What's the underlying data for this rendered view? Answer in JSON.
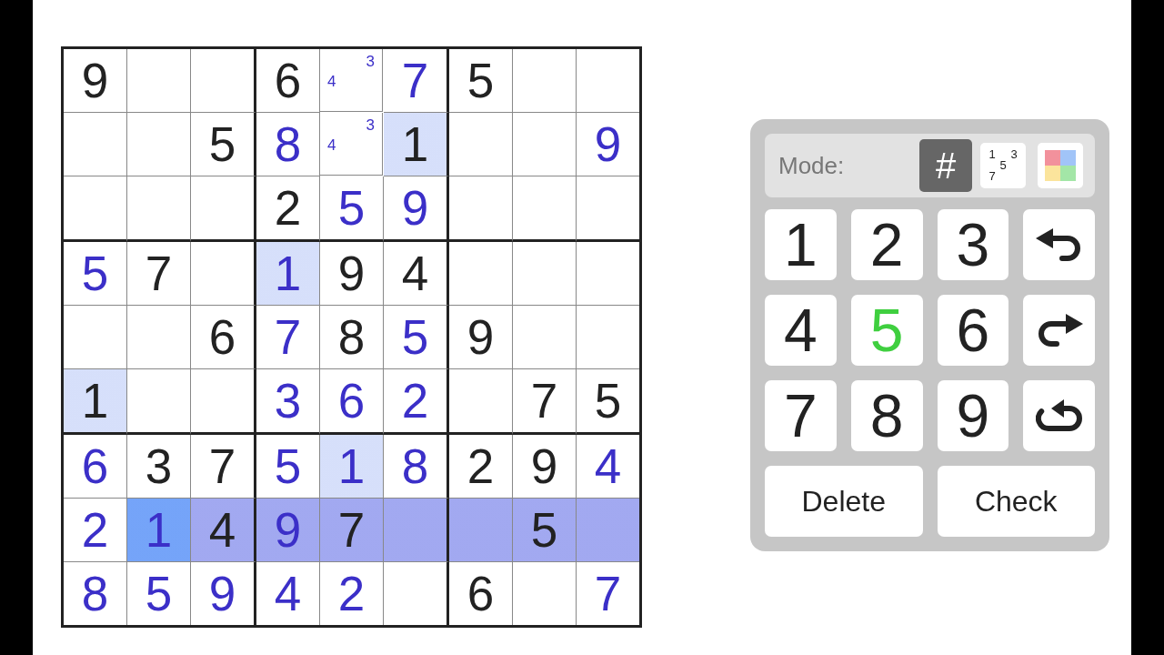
{
  "board": {
    "rows": [
      [
        {
          "kind": "given",
          "value": "9",
          "same_digit": false,
          "in_row": false,
          "selected": false
        },
        {
          "kind": "empty",
          "same_digit": false,
          "in_row": false,
          "selected": false
        },
        {
          "kind": "empty",
          "same_digit": false,
          "in_row": false,
          "selected": false
        },
        {
          "kind": "given",
          "value": "6",
          "same_digit": false,
          "in_row": false,
          "selected": false
        },
        {
          "kind": "notes",
          "notes": [
            {
              "text": "3",
              "kind": "top-right"
            },
            {
              "text": "4",
              "kind": "middle-left"
            }
          ],
          "same_digit": false,
          "in_row": false,
          "selected": false
        },
        {
          "kind": "entry",
          "value": "7",
          "same_digit": false,
          "in_row": false,
          "selected": false
        },
        {
          "kind": "given",
          "value": "5",
          "same_digit": false,
          "in_row": false,
          "selected": false
        },
        {
          "kind": "empty",
          "same_digit": false,
          "in_row": false,
          "selected": false
        },
        {
          "kind": "empty",
          "same_digit": false,
          "in_row": false,
          "selected": false
        }
      ],
      [
        {
          "kind": "empty",
          "same_digit": false,
          "in_row": false,
          "selected": false
        },
        {
          "kind": "empty",
          "same_digit": false,
          "in_row": false,
          "selected": false
        },
        {
          "kind": "given",
          "value": "5",
          "same_digit": false,
          "in_row": false,
          "selected": false
        },
        {
          "kind": "entry",
          "value": "8",
          "same_digit": false,
          "in_row": false,
          "selected": false
        },
        {
          "kind": "notes",
          "notes": [
            {
              "text": "3",
              "kind": "top-right"
            },
            {
              "text": "4",
              "kind": "middle-left"
            }
          ],
          "same_digit": false,
          "in_row": false,
          "selected": false
        },
        {
          "kind": "given",
          "value": "1",
          "same_digit": true,
          "in_row": false,
          "selected": false
        },
        {
          "kind": "empty",
          "same_digit": false,
          "in_row": false,
          "selected": false
        },
        {
          "kind": "empty",
          "same_digit": false,
          "in_row": false,
          "selected": false
        },
        {
          "kind": "entry",
          "value": "9",
          "same_digit": false,
          "in_row": false,
          "selected": false
        }
      ],
      [
        {
          "kind": "empty",
          "same_digit": false,
          "in_row": false,
          "selected": false
        },
        {
          "kind": "empty",
          "same_digit": false,
          "in_row": false,
          "selected": false
        },
        {
          "kind": "empty",
          "same_digit": false,
          "in_row": false,
          "selected": false
        },
        {
          "kind": "given",
          "value": "2",
          "same_digit": false,
          "in_row": false,
          "selected": false
        },
        {
          "kind": "entry",
          "value": "5",
          "same_digit": false,
          "in_row": false,
          "selected": false
        },
        {
          "kind": "entry",
          "value": "9",
          "same_digit": false,
          "in_row": false,
          "selected": false
        },
        {
          "kind": "empty",
          "same_digit": false,
          "in_row": false,
          "selected": false
        },
        {
          "kind": "empty",
          "same_digit": false,
          "in_row": false,
          "selected": false
        },
        {
          "kind": "empty",
          "same_digit": false,
          "in_row": false,
          "selected": false
        }
      ],
      [
        {
          "kind": "entry",
          "value": "5",
          "same_digit": false,
          "in_row": false,
          "selected": false
        },
        {
          "kind": "given",
          "value": "7",
          "same_digit": false,
          "in_row": false,
          "selected": false
        },
        {
          "kind": "empty",
          "same_digit": false,
          "in_row": false,
          "selected": false
        },
        {
          "kind": "entry",
          "value": "1",
          "same_digit": true,
          "in_row": false,
          "selected": false
        },
        {
          "kind": "given",
          "value": "9",
          "same_digit": false,
          "in_row": false,
          "selected": false
        },
        {
          "kind": "given",
          "value": "4",
          "same_digit": false,
          "in_row": false,
          "selected": false
        },
        {
          "kind": "empty",
          "same_digit": false,
          "in_row": false,
          "selected": false
        },
        {
          "kind": "empty",
          "same_digit": false,
          "in_row": false,
          "selected": false
        },
        {
          "kind": "empty",
          "same_digit": false,
          "in_row": false,
          "selected": false
        }
      ],
      [
        {
          "kind": "empty",
          "same_digit": false,
          "in_row": false,
          "selected": false
        },
        {
          "kind": "empty",
          "same_digit": false,
          "in_row": false,
          "selected": false
        },
        {
          "kind": "given",
          "value": "6",
          "same_digit": false,
          "in_row": false,
          "selected": false
        },
        {
          "kind": "entry",
          "value": "7",
          "same_digit": false,
          "in_row": false,
          "selected": false
        },
        {
          "kind": "given",
          "value": "8",
          "same_digit": false,
          "in_row": false,
          "selected": false
        },
        {
          "kind": "entry",
          "value": "5",
          "same_digit": false,
          "in_row": false,
          "selected": false
        },
        {
          "kind": "given",
          "value": "9",
          "same_digit": false,
          "in_row": false,
          "selected": false
        },
        {
          "kind": "empty",
          "same_digit": false,
          "in_row": false,
          "selected": false
        },
        {
          "kind": "empty",
          "same_digit": false,
          "in_row": false,
          "selected": false
        }
      ],
      [
        {
          "kind": "given",
          "value": "1",
          "same_digit": true,
          "in_row": false,
          "selected": false
        },
        {
          "kind": "empty",
          "same_digit": false,
          "in_row": false,
          "selected": false
        },
        {
          "kind": "empty",
          "same_digit": false,
          "in_row": false,
          "selected": false
        },
        {
          "kind": "entry",
          "value": "3",
          "same_digit": false,
          "in_row": false,
          "selected": false
        },
        {
          "kind": "entry",
          "value": "6",
          "same_digit": false,
          "in_row": false,
          "selected": false
        },
        {
          "kind": "entry",
          "value": "2",
          "same_digit": false,
          "in_row": false,
          "selected": false
        },
        {
          "kind": "empty",
          "same_digit": false,
          "in_row": false,
          "selected": false
        },
        {
          "kind": "given",
          "value": "7",
          "same_digit": false,
          "in_row": false,
          "selected": false
        },
        {
          "kind": "given",
          "value": "5",
          "same_digit": false,
          "in_row": false,
          "selected": false
        }
      ],
      [
        {
          "kind": "entry",
          "value": "6",
          "same_digit": false,
          "in_row": false,
          "selected": false
        },
        {
          "kind": "given",
          "value": "3",
          "same_digit": false,
          "in_row": false,
          "selected": false
        },
        {
          "kind": "given",
          "value": "7",
          "same_digit": false,
          "in_row": false,
          "selected": false
        },
        {
          "kind": "entry",
          "value": "5",
          "same_digit": false,
          "in_row": false,
          "selected": false
        },
        {
          "kind": "entry",
          "value": "1",
          "same_digit": true,
          "in_row": false,
          "selected": false
        },
        {
          "kind": "entry",
          "value": "8",
          "same_digit": false,
          "in_row": false,
          "selected": false
        },
        {
          "kind": "given",
          "value": "2",
          "same_digit": false,
          "in_row": false,
          "selected": false
        },
        {
          "kind": "given",
          "value": "9",
          "same_digit": false,
          "in_row": false,
          "selected": false
        },
        {
          "kind": "entry",
          "value": "4",
          "same_digit": false,
          "in_row": false,
          "selected": false
        }
      ],
      [
        {
          "kind": "entry",
          "value": "2",
          "same_digit": false,
          "in_row": false,
          "selected": false
        },
        {
          "kind": "entry",
          "value": "1",
          "same_digit": false,
          "in_row": true,
          "selected": true
        },
        {
          "kind": "given",
          "value": "4",
          "same_digit": false,
          "in_row": true,
          "selected": false
        },
        {
          "kind": "entry",
          "value": "9",
          "same_digit": false,
          "in_row": true,
          "selected": false
        },
        {
          "kind": "given",
          "value": "7",
          "same_digit": false,
          "in_row": true,
          "selected": false
        },
        {
          "kind": "empty",
          "same_digit": false,
          "in_row": true,
          "selected": false
        },
        {
          "kind": "empty",
          "same_digit": false,
          "in_row": true,
          "selected": false
        },
        {
          "kind": "given",
          "value": "5",
          "same_digit": false,
          "in_row": true,
          "selected": false
        },
        {
          "kind": "empty",
          "same_digit": false,
          "in_row": true,
          "selected": false
        }
      ],
      [
        {
          "kind": "entry",
          "value": "8",
          "same_digit": false,
          "in_row": false,
          "selected": false
        },
        {
          "kind": "entry",
          "value": "5",
          "same_digit": false,
          "in_row": false,
          "selected": false
        },
        {
          "kind": "entry",
          "value": "9",
          "same_digit": false,
          "in_row": false,
          "selected": false
        },
        {
          "kind": "entry",
          "value": "4",
          "same_digit": false,
          "in_row": false,
          "selected": false
        },
        {
          "kind": "entry",
          "value": "2",
          "same_digit": false,
          "in_row": false,
          "selected": false
        },
        {
          "kind": "empty",
          "same_digit": false,
          "in_row": false,
          "selected": false
        },
        {
          "kind": "given",
          "value": "6",
          "same_digit": false,
          "in_row": false,
          "selected": false
        },
        {
          "kind": "empty",
          "same_digit": false,
          "in_row": false,
          "selected": false
        },
        {
          "kind": "entry",
          "value": "7",
          "same_digit": false,
          "in_row": false,
          "selected": false
        }
      ]
    ]
  },
  "panel": {
    "mode_label": "Mode:",
    "modes": [
      {
        "kind": "digit",
        "label": "#",
        "selected": true
      },
      {
        "kind": "notes",
        "digits": [
          {
            "text": "1",
            "kind": "top-left"
          },
          {
            "text": "3",
            "kind": "top-right"
          },
          {
            "text": "5",
            "kind": "center"
          },
          {
            "text": "7",
            "kind": "bottom-left"
          }
        ],
        "selected": false
      },
      {
        "kind": "color",
        "selected": false
      }
    ],
    "keys": [
      {
        "kind": "digit",
        "label": "1",
        "complete": false
      },
      {
        "kind": "digit",
        "label": "2",
        "complete": false
      },
      {
        "kind": "digit",
        "label": "3",
        "complete": false
      },
      {
        "kind": "undo",
        "complete": false
      },
      {
        "kind": "digit",
        "label": "4",
        "complete": false
      },
      {
        "kind": "digit",
        "label": "5",
        "complete": true
      },
      {
        "kind": "digit",
        "label": "6",
        "complete": false
      },
      {
        "kind": "redo",
        "complete": false
      },
      {
        "kind": "digit",
        "label": "7",
        "complete": false
      },
      {
        "kind": "digit",
        "label": "8",
        "complete": false
      },
      {
        "kind": "digit",
        "label": "9",
        "complete": false
      },
      {
        "kind": "restart",
        "complete": false
      }
    ],
    "delete_button": {
      "label": "Delete"
    },
    "check_button": {
      "label": "Check"
    }
  }
}
